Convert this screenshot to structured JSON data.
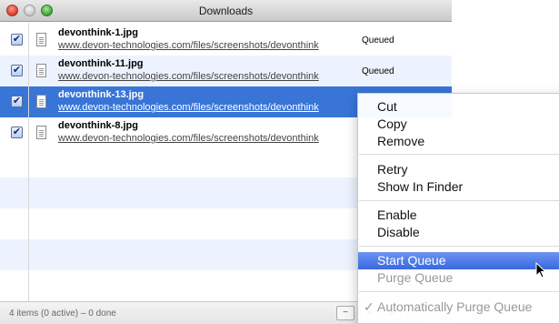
{
  "window": {
    "title": "Downloads"
  },
  "rows": [
    {
      "checked": "✔",
      "name": "devonthink-1.jpg",
      "url": "www.devon-technologies.com/files/screenshots/devonthink",
      "status": "Queued"
    },
    {
      "checked": "✔",
      "name": "devonthink-11.jpg",
      "url": "www.devon-technologies.com/files/screenshots/devonthink",
      "status": "Queued"
    },
    {
      "checked": "✔",
      "name": "devonthink-13.jpg",
      "url": "www.devon-technologies.com/files/screenshots/devonthink",
      "status": ""
    },
    {
      "checked": "✔",
      "name": "devonthink-8.jpg",
      "url": "www.devon-technologies.com/files/screenshots/devonthink",
      "status": ""
    }
  ],
  "footer": {
    "summary": "4 items (0 active) – 0 done"
  },
  "context_menu": {
    "cut": "Cut",
    "copy": "Copy",
    "remove": "Remove",
    "retry": "Retry",
    "show_in_finder": "Show In Finder",
    "enable": "Enable",
    "disable": "Disable",
    "start_queue": "Start Queue",
    "purge_queue": "Purge Queue",
    "auto_purge_check": "✓",
    "auto_purge": "Automatically Purge Queue"
  },
  "colors": {
    "selection": "#3875d7",
    "menu_highlight": "#3a69e0",
    "alt_row": "#edf3fe"
  }
}
